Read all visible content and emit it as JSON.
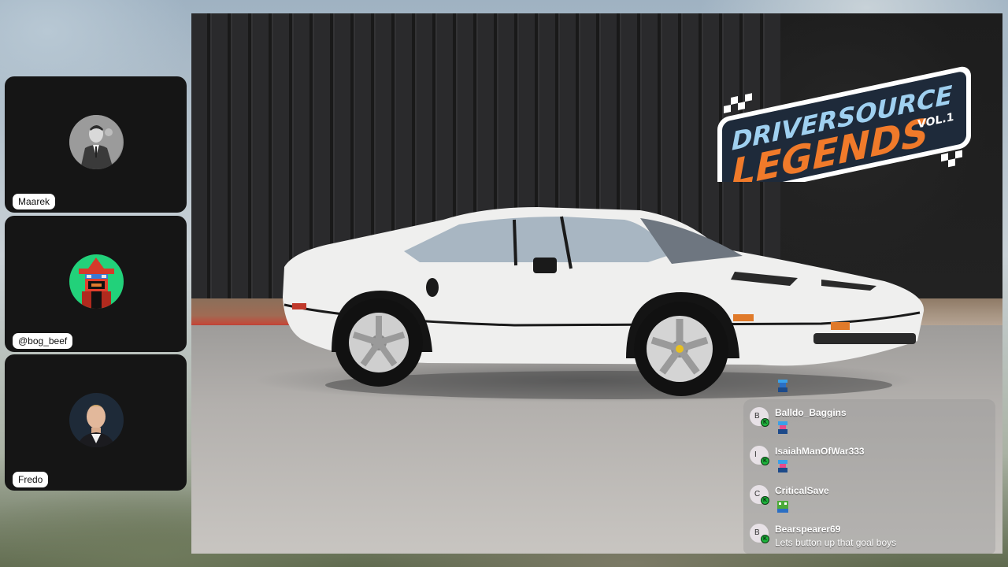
{
  "participants": [
    {
      "name": "Maarek",
      "avatar": "portrait-black-white-man-in-suit"
    },
    {
      "name": "@bog_beef",
      "avatar": "pixel-art-red-wizard-on-green"
    },
    {
      "name": "Fredo",
      "avatar": "portrait-blond-man"
    }
  ],
  "stage": {
    "logo": {
      "line1": "DRIVERSOURCE",
      "line2": "LEGENDS",
      "volume": "VOL.1"
    },
    "scene": "white-sports-car-in-front-of-dark-building"
  },
  "chat": {
    "messages": [
      {
        "initial": "B",
        "user": "Balldo_Baggins",
        "emote": "blue-pixel-figure-emote",
        "badge": "K"
      },
      {
        "initial": "I",
        "user": "IsaiahManOfWar333",
        "emote": "blue-pixel-figure-emote",
        "badge": "K"
      },
      {
        "initial": "C",
        "user": "CriticalSave",
        "emote": "green-frog-emote",
        "badge": "K"
      },
      {
        "initial": "B",
        "user": "Bearspearer69",
        "text": "Lets button up that goal boys",
        "badge": "K"
      }
    ]
  },
  "colors": {
    "tile_background": "#151515",
    "chat_background": "rgba(150,150,150,0.38)",
    "badge_green": "#1db33c",
    "logo_orange": "#f07a2a",
    "logo_blue": "#9fd0f0"
  }
}
